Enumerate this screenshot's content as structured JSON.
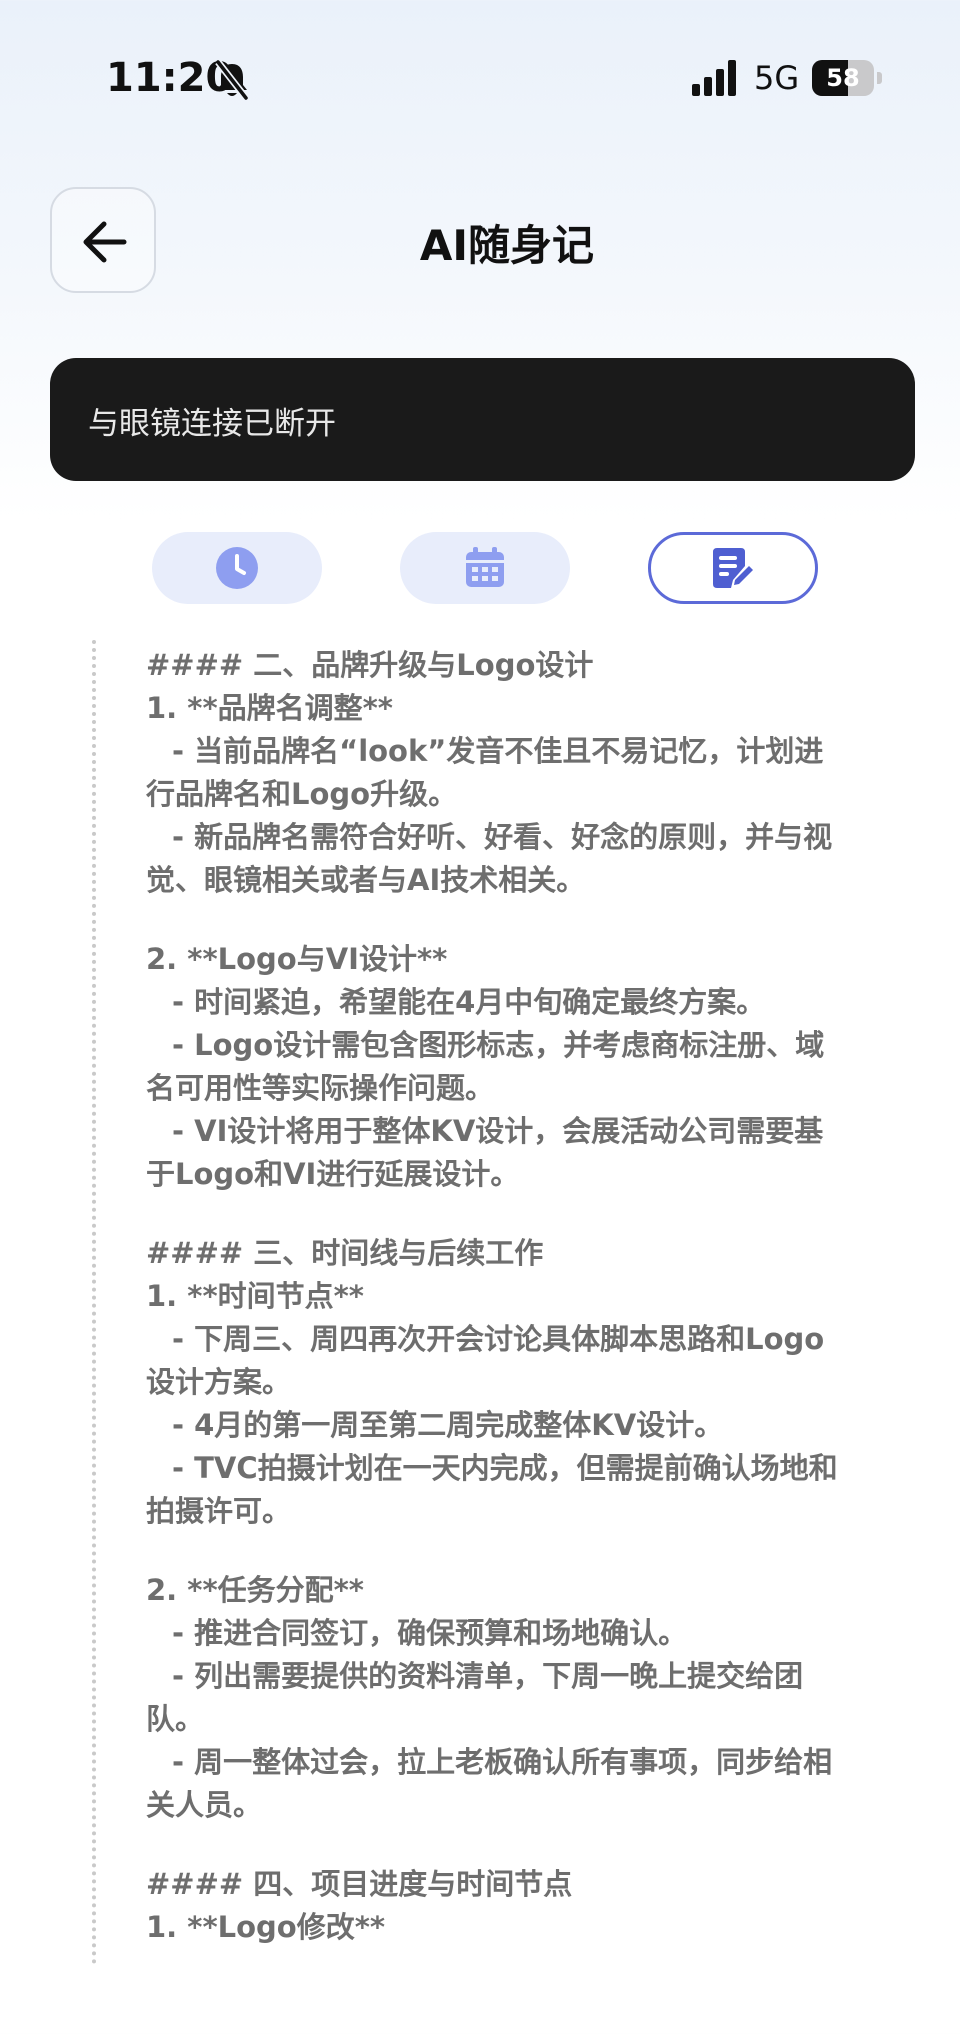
{
  "status_bar": {
    "time": "11:20",
    "network": "5G",
    "battery": "58",
    "battery_level": 0.58
  },
  "header": {
    "title": "AI随身记"
  },
  "banner": {
    "text": "与眼镜连接已断开"
  },
  "tabs": [
    {
      "icon": "clock-icon",
      "active": false
    },
    {
      "icon": "calendar-icon",
      "active": false
    },
    {
      "icon": "notes-edit-icon",
      "active": true
    }
  ],
  "colors": {
    "accent": "#5c6ad8",
    "tab_bg": "#e8edfb",
    "icon_blue": "#8e9ef0",
    "banner_bg": "#1a1a1a",
    "body_text": "#6e6e6e"
  },
  "content": {
    "lines": [
      "#### 二、品牌升级与Logo设计",
      "1. **品牌名调整**",
      "  - 当前品牌名“look”发音不佳且不易记忆，计划进",
      "行品牌名和Logo升级。",
      "  - 新品牌名需符合好听、好看、好念的原则，并与视",
      "觉、眼镜相关或者与AI技术相关。",
      "",
      "2. **Logo与VI设计**",
      "  - 时间紧迫，希望能在4月中旬确定最终方案。",
      "  - Logo设计需包含图形标志，并考虑商标注册、域",
      "名可用性等实际操作问题。",
      "  - VI设计将用于整体KV设计，会展活动公司需要基",
      "于Logo和VI进行延展设计。",
      "",
      "#### 三、时间线与后续工作",
      "1. **时间节点**",
      "  - 下周三、周四再次开会讨论具体脚本思路和Logo",
      "设计方案。",
      "  - 4月的第一周至第二周完成整体KV设计。",
      "  - TVC拍摄计划在一天内完成，但需提前确认场地和",
      "拍摄许可。",
      "",
      "2. **任务分配**",
      "  - 推进合同签订，确保预算和场地确认。",
      "  - 列出需要提供的资料清单，下周一晚上提交给团",
      "队。",
      "  - 周一整体过会，拉上老板确认所有事项，同步给相",
      "关人员。",
      "",
      "#### 四、项目进度与时间节点",
      "1. **Logo修改**"
    ]
  }
}
